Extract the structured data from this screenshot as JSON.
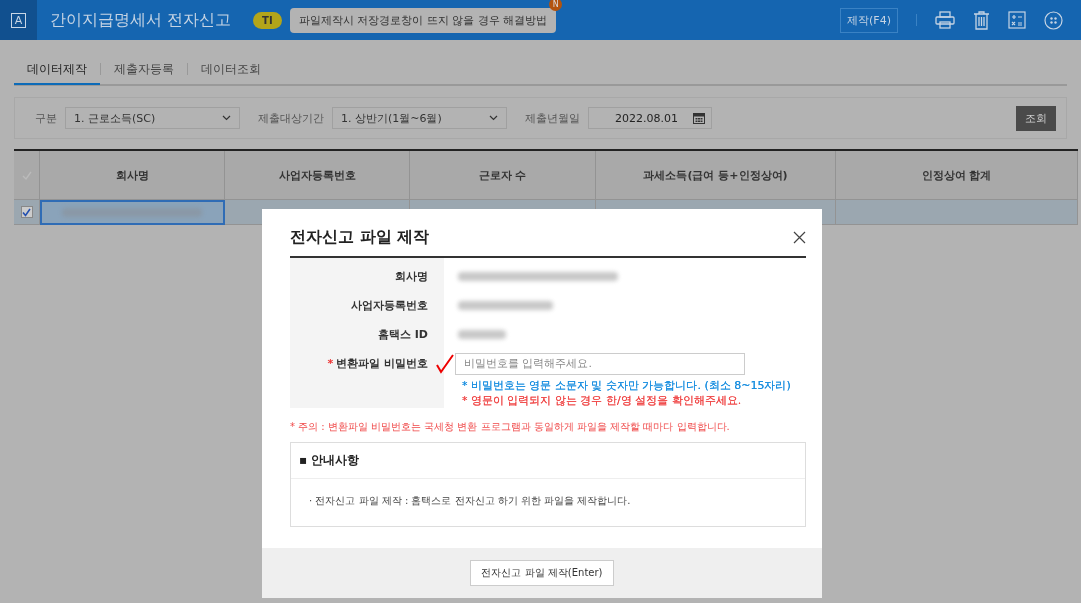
{
  "header": {
    "logo": "A",
    "title": "간이지급명세서 전자신고",
    "badge": "TI",
    "tip": "파일제작시 저장경로창이 뜨지 않을 경우 해결방법",
    "tip_mark": "N",
    "make_button": "제작(F4)"
  },
  "tabs": [
    {
      "label": "데이터제작",
      "selected": true
    },
    {
      "label": "제출자등록",
      "selected": false
    },
    {
      "label": "데이터조회",
      "selected": false
    }
  ],
  "filters": [
    {
      "kind": "select",
      "label": "구분",
      "value": "1. 근로소득(SC)"
    },
    {
      "kind": "select",
      "label": "제출대상기간",
      "value": "1. 상반기(1월~6월)"
    },
    {
      "kind": "date",
      "label": "제출년월일",
      "value": "2022.08.01"
    }
  ],
  "search_button": "조회",
  "table": {
    "columns": [
      "회사명",
      "사업자등록번호",
      "근로자 수",
      "과세소득(급여 등+인정상여)",
      "인정상여 합계"
    ],
    "rows": [
      {
        "checked": true,
        "selected": true
      }
    ]
  },
  "dialog": {
    "title": "전자신고 파일 제작",
    "required_mark": "*",
    "fields": [
      {
        "kind": "hidden",
        "label": "회사명",
        "required": false
      },
      {
        "kind": "hidden",
        "label": "사업자등록번호",
        "required": false
      },
      {
        "kind": "hidden",
        "label": "홈택스 ID",
        "required": false
      },
      {
        "kind": "input",
        "label": "변환파일 비밀번호",
        "required": true,
        "placeholder": "비밀번호를 입력해주세요."
      }
    ],
    "hints": [
      {
        "text": "* 비밀번호는 영문 소문자 및 숫자만 가능합니다. (최소 8~15자리)",
        "color": "#1a8fe0"
      },
      {
        "text": "* 영문이 입력되지 않는 경우 한/영 설정을 확인해주세요.",
        "color": "#f04848"
      }
    ],
    "warning": "* 주의 : 변환파일 비밀번호는 국세청 변환 프로그램과 동일하게 파일을 제작할 때마다 입력합니다.",
    "notice": {
      "title": "▪ 안내사항",
      "items": [
        "· 전자신고 파일 제작 : 홈택스로 전자신고 하기 위한 파일을 제작합니다."
      ]
    },
    "submit_button": "전자신고 파일 제작(Enter)"
  }
}
